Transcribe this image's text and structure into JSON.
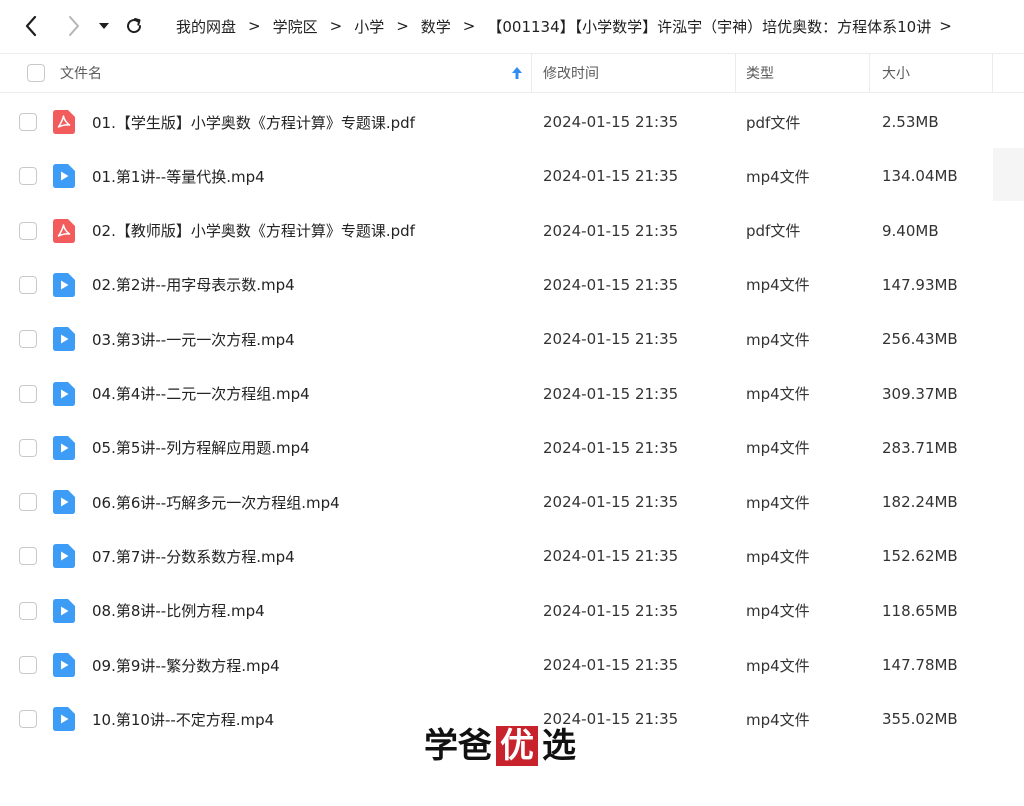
{
  "breadcrumb": {
    "items": [
      "我的网盘",
      "学院区",
      "小学",
      "数学",
      "【001134】【小学数学】许泓宇（宇神）培优奥数：方程体系10讲"
    ]
  },
  "header": {
    "name_label": "文件名",
    "modified_label": "修改时间",
    "type_label": "类型",
    "size_label": "大小"
  },
  "icons": {
    "pdf": "pdf-file-icon",
    "video": "video-file-icon",
    "pdf_color": "#f25c5c",
    "video_color": "#3d9cf5"
  },
  "files": [
    {
      "kind": "pdf",
      "name": "01.【学生版】小学奥数《方程计算》专题课.pdf",
      "modified": "2024-01-15 21:35",
      "type": "pdf文件",
      "size": "2.53MB"
    },
    {
      "kind": "video",
      "name": "01.第1讲--等量代换.mp4",
      "modified": "2024-01-15 21:35",
      "type": "mp4文件",
      "size": "134.04MB"
    },
    {
      "kind": "pdf",
      "name": "02.【教师版】小学奥数《方程计算》专题课.pdf",
      "modified": "2024-01-15 21:35",
      "type": "pdf文件",
      "size": "9.40MB"
    },
    {
      "kind": "video",
      "name": "02.第2讲--用字母表示数.mp4",
      "modified": "2024-01-15 21:35",
      "type": "mp4文件",
      "size": "147.93MB"
    },
    {
      "kind": "video",
      "name": "03.第3讲--一元一次方程.mp4",
      "modified": "2024-01-15 21:35",
      "type": "mp4文件",
      "size": "256.43MB"
    },
    {
      "kind": "video",
      "name": "04.第4讲--二元一次方程组.mp4",
      "modified": "2024-01-15 21:35",
      "type": "mp4文件",
      "size": "309.37MB"
    },
    {
      "kind": "video",
      "name": "05.第5讲--列方程解应用题.mp4",
      "modified": "2024-01-15 21:35",
      "type": "mp4文件",
      "size": "283.71MB"
    },
    {
      "kind": "video",
      "name": "06.第6讲--巧解多元一次方程组.mp4",
      "modified": "2024-01-15 21:35",
      "type": "mp4文件",
      "size": "182.24MB"
    },
    {
      "kind": "video",
      "name": "07.第7讲--分数系数方程.mp4",
      "modified": "2024-01-15 21:35",
      "type": "mp4文件",
      "size": "152.62MB"
    },
    {
      "kind": "video",
      "name": "08.第8讲--比例方程.mp4",
      "modified": "2024-01-15 21:35",
      "type": "mp4文件",
      "size": "118.65MB"
    },
    {
      "kind": "video",
      "name": "09.第9讲--繁分数方程.mp4",
      "modified": "2024-01-15 21:35",
      "type": "mp4文件",
      "size": "147.78MB"
    },
    {
      "kind": "video",
      "name": "10.第10讲--不定方程.mp4",
      "modified": "2024-01-15 21:35",
      "type": "mp4文件",
      "size": "355.02MB"
    }
  ],
  "watermark": {
    "chars": [
      "学",
      "爸",
      "优",
      "选"
    ],
    "highlight_color": "#c8232c"
  }
}
